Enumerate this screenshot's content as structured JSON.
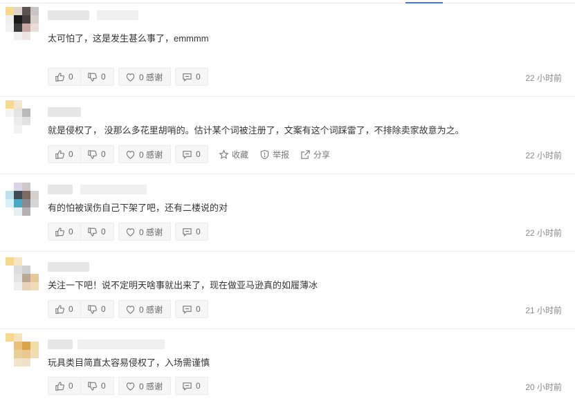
{
  "colors": {
    "accent": "#3b78d8",
    "button_bg": "#f6f6f6",
    "text": "#333333",
    "muted": "#888888"
  },
  "comments": [
    {
      "text": "太可怕了，这是发生甚么事了，emmmm",
      "like_count": "0",
      "dislike_count": "0",
      "thanks_label": "0 感谢",
      "reply_count": "0",
      "time": "22 小时前"
    },
    {
      "text": "就是侵权了， 没那么多花里胡哨的。估计某个词被注册了，文案有这个词踩雷了，不排除卖家故意为之。",
      "like_count": "0",
      "dislike_count": "0",
      "thanks_label": "0 感谢",
      "reply_count": "0",
      "time": "22 小时前",
      "extra_actions": {
        "favorite": "收藏",
        "report": "举报",
        "share": "分享"
      }
    },
    {
      "text": "有的怕被误伤自己下架了吧，还有二楼说的对",
      "like_count": "0",
      "dislike_count": "0",
      "thanks_label": "0 感谢",
      "reply_count": "0",
      "time": "22 小时前"
    },
    {
      "text": "关注一下吧！说不定明天啥事就出来了，现在做亚马逊真的如履薄冰",
      "like_count": "0",
      "dislike_count": "0",
      "thanks_label": "0 感谢",
      "reply_count": "0",
      "time": "21 小时前"
    },
    {
      "text": "玩具类目简直太容易侵权了，入场需谨慎",
      "like_count": "0",
      "dislike_count": "0",
      "thanks_label": "0 感谢",
      "reply_count": "0",
      "time": "20 小时前"
    }
  ],
  "icons": {
    "like": "thumbs-up-icon",
    "dislike": "thumbs-down-icon",
    "thanks": "heart-icon",
    "reply": "comment-icon",
    "favorite": "star-icon",
    "report": "shield-icon",
    "share": "share-icon"
  }
}
